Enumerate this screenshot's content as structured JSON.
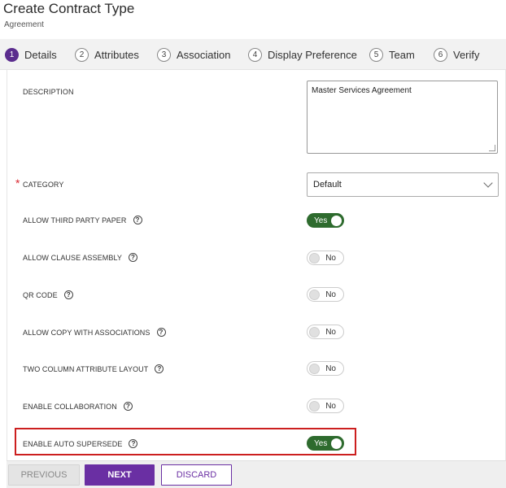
{
  "header": {
    "title": "Create Contract Type",
    "subtitle": "Agreement"
  },
  "tabs": [
    {
      "num": "1",
      "label": "Details",
      "active": true
    },
    {
      "num": "2",
      "label": "Attributes"
    },
    {
      "num": "3",
      "label": "Association"
    },
    {
      "num": "4",
      "label": "Display Preference"
    },
    {
      "num": "5",
      "label": "Team"
    },
    {
      "num": "6",
      "label": "Verify"
    }
  ],
  "form": {
    "description": {
      "label": "DESCRIPTION",
      "value": "Master Services Agreement"
    },
    "category": {
      "label": "CATEGORY",
      "required_mark": "*",
      "value": "Default"
    },
    "help_glyph": "?",
    "settings": [
      {
        "label": "ALLOW THIRD PARTY PAPER",
        "value": "Yes"
      },
      {
        "label": "ALLOW CLAUSE ASSEMBLY",
        "value": "No"
      },
      {
        "label": "QR CODE",
        "value": "No"
      },
      {
        "label": "ALLOW COPY WITH ASSOCIATIONS",
        "value": "No"
      },
      {
        "label": "TWO COLUMN ATTRIBUTE LAYOUT",
        "value": "No"
      },
      {
        "label": "ENABLE COLLABORATION",
        "value": "No"
      },
      {
        "label": "ENABLE AUTO SUPERSEDE",
        "value": "Yes"
      }
    ]
  },
  "footer": {
    "previous_label": "PREVIOUS",
    "next_label": "NEXT",
    "discard_label": "DISCARD"
  },
  "colors": {
    "accent": "#6a2fa3",
    "toggle_on": "#2e6b2e",
    "highlight": "#cc1f1f"
  }
}
